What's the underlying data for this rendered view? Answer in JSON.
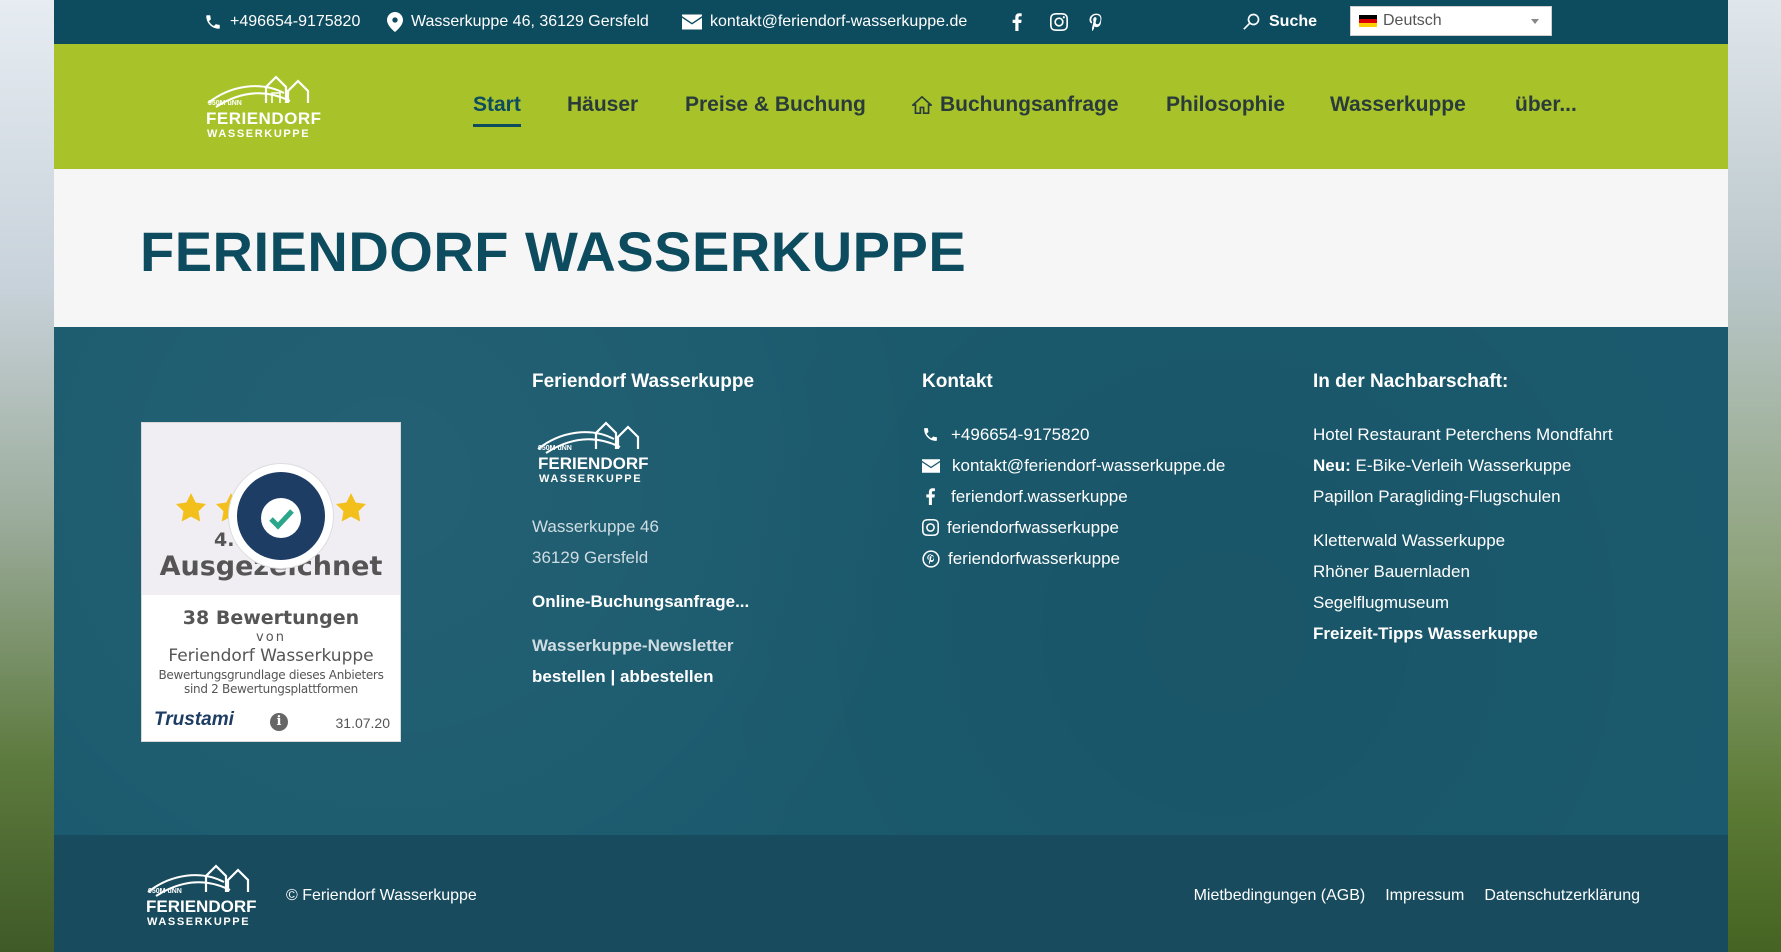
{
  "topbar": {
    "phone": "+496654-9175820",
    "address": "Wasserkuppe 46, 36129 Gersfeld",
    "email": "kontakt@feriendorf-wasserkuppe.de",
    "search_label": "Suche",
    "language": "Deutsch",
    "social_icons": [
      "facebook-icon",
      "instagram-icon",
      "pinterest-icon"
    ]
  },
  "logo": {
    "line1": "950M üNN",
    "line2": "FERIENDORF",
    "line3": "WASSERKUPPE"
  },
  "nav": {
    "items": [
      {
        "label": "Start",
        "active": true
      },
      {
        "label": "Häuser"
      },
      {
        "label": "Preise & Buchung"
      },
      {
        "label": "Buchungsanfrage",
        "icon": "home-icon"
      },
      {
        "label": "Philosophie"
      },
      {
        "label": "Wasserkuppe"
      },
      {
        "label": "über..."
      }
    ]
  },
  "page": {
    "title": "FERIENDORF WASSERKUPPE"
  },
  "trustami": {
    "rating": "4.87 / 5.00",
    "verdict": "Ausgezeichnet",
    "count": "38 Bewertungen",
    "von": "von",
    "company": "Feriendorf Wasserkuppe",
    "basis": "Bewertungsgrundlage dieses Anbieters sind 2 Bewertungsplattformen",
    "brand": "Trustami",
    "date": "31.07.20"
  },
  "footer": {
    "col1": {
      "heading": "Feriendorf Wasserkuppe",
      "street": "Wasserkuppe 46",
      "city": "36129 Gersfeld",
      "booking_link": "Online-Buchungsanfrage...",
      "newsletter_label": "Wasserkuppe-Newsletter",
      "newsletter_subscribe": "bestellen",
      "newsletter_sep": "|",
      "newsletter_unsubscribe": "abbestellen"
    },
    "col2": {
      "heading": "Kontakt",
      "phone": "+496654-9175820",
      "email": "kontakt@feriendorf-wasserkuppe.de",
      "facebook": "feriendorf.wasserkuppe",
      "instagram": "feriendorfwasserkuppe",
      "pinterest": "feriendorfwasserkuppe"
    },
    "col3": {
      "heading": "In der Nachbarschaft:",
      "links": [
        "Hotel Restaurant Peterchens Mondfahrt",
        "E-Bike-Verleih Wasserkuppe",
        "Papillon Paragliding-Flugschulen",
        "Kletterwald Wasserkuppe",
        "Rhöner Bauernladen",
        "Segelflugmuseum"
      ],
      "neu_label": "Neu:",
      "tips_link": "Freizeit-Tipps Wasserkuppe"
    }
  },
  "bottombar": {
    "copyright": "© Feriendorf Wasserkuppe",
    "links": [
      "Mietbedingungen (AGB)",
      "Impressum",
      "Datenschutzerklärung"
    ]
  },
  "colors": {
    "topbar": "#0d4b5f",
    "header": "#a8c22a",
    "title": "#0d4b5f",
    "footer": "#1b5a6e"
  }
}
